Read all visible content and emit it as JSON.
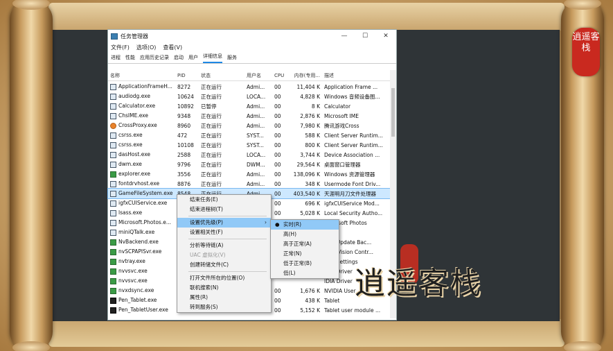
{
  "window": {
    "title": "任务管理器",
    "minimize": "—",
    "maximize": "☐",
    "close": "✕"
  },
  "menubar": [
    "文件(F)",
    "选项(O)",
    "查看(V)"
  ],
  "tabs": [
    "进程",
    "性能",
    "应用历史记录",
    "启动",
    "用户",
    "详细信息",
    "服务"
  ],
  "active_tab": "详细信息",
  "columns": [
    "名称",
    "PID",
    "状态",
    "用户名",
    "CPU",
    "内存(专用...",
    "描述"
  ],
  "rows": [
    {
      "name": "ApplicationFrameH...",
      "pid": "8272",
      "status": "正在运行",
      "user": "Admi...",
      "cpu": "00",
      "mem": "11,404 K",
      "desc": "Application Frame ..."
    },
    {
      "name": "audiodg.exe",
      "pid": "10624",
      "status": "正在运行",
      "user": "LOCA...",
      "cpu": "00",
      "mem": "4,828 K",
      "desc": "Windows 音频设备图..."
    },
    {
      "name": "Calculator.exe",
      "pid": "10892",
      "status": "已暂停",
      "user": "Admi...",
      "cpu": "00",
      "mem": "8 K",
      "desc": "Calculator"
    },
    {
      "name": "ChsIME.exe",
      "pid": "9348",
      "status": "正在运行",
      "user": "Admi...",
      "cpu": "00",
      "mem": "2,876 K",
      "desc": "Microsoft IME"
    },
    {
      "name": "CrossProxy.exe",
      "pid": "8960",
      "status": "正在运行",
      "user": "Admi...",
      "cpu": "00",
      "mem": "7,980 K",
      "desc": "腾讯游戏Cross"
    },
    {
      "name": "csrss.exe",
      "pid": "472",
      "status": "正在运行",
      "user": "SYST...",
      "cpu": "00",
      "mem": "588 K",
      "desc": "Client Server Runtim..."
    },
    {
      "name": "csrss.exe",
      "pid": "10108",
      "status": "正在运行",
      "user": "SYST...",
      "cpu": "00",
      "mem": "800 K",
      "desc": "Client Server Runtim..."
    },
    {
      "name": "dasHost.exe",
      "pid": "2588",
      "status": "正在运行",
      "user": "LOCA...",
      "cpu": "00",
      "mem": "3,744 K",
      "desc": "Device Association ..."
    },
    {
      "name": "dwm.exe",
      "pid": "9796",
      "status": "正在运行",
      "user": "DWM...",
      "cpu": "00",
      "mem": "29,564 K",
      "desc": "桌面窗口管理器"
    },
    {
      "name": "explorer.exe",
      "pid": "3556",
      "status": "正在运行",
      "user": "Admi...",
      "cpu": "00",
      "mem": "138,096 K",
      "desc": "Windows 资源管理器"
    },
    {
      "name": "fontdrvhost.exe",
      "pid": "8876",
      "status": "正在运行",
      "user": "Admi...",
      "cpu": "00",
      "mem": "348 K",
      "desc": "Usermode Font Driv..."
    },
    {
      "name": "GameFileSystem.exe",
      "pid": "8548",
      "status": "正在运行",
      "user": "Admi...",
      "cpu": "00",
      "mem": "403,540 K",
      "desc": "天涯明月刀文件处理器"
    },
    {
      "name": "igfxCUIService.exe",
      "pid": "",
      "status": "",
      "user": "",
      "cpu": "00",
      "mem": "696 K",
      "desc": "igfxCUIService Mod..."
    },
    {
      "name": "lsass.exe",
      "pid": "",
      "status": "",
      "user": "",
      "cpu": "00",
      "mem": "5,028 K",
      "desc": "Local Security Autho..."
    },
    {
      "name": "Microsoft.Photos.e...",
      "pid": "",
      "status": "",
      "user": "",
      "cpu": "",
      "mem": "",
      "desc": "Microsoft Photos"
    },
    {
      "name": "miniQTalk.exe",
      "pid": "",
      "status": "",
      "user": "",
      "cpu": "",
      "mem": "",
      "desc": ""
    },
    {
      "name": "NvBackend.exe",
      "pid": "",
      "status": "",
      "user": "",
      "cpu": "",
      "mem": "",
      "desc": "IDIA Update Bac..."
    },
    {
      "name": "nvSCPAPISvr.exe",
      "pid": "",
      "status": "",
      "user": "",
      "cpu": "",
      "mem": "",
      "desc": "ereo Vision Contr..."
    },
    {
      "name": "nvtray.exe",
      "pid": "",
      "status": "",
      "user": "",
      "cpu": "",
      "mem": "",
      "desc": "IDIA Settings"
    },
    {
      "name": "nvvsvc.exe",
      "pid": "",
      "status": "",
      "user": "",
      "cpu": "",
      "mem": "",
      "desc": "IDIA Driver"
    },
    {
      "name": "nvvsvc.exe",
      "pid": "",
      "status": "",
      "user": "",
      "cpu": "",
      "mem": "",
      "desc": "IDIA Driver"
    },
    {
      "name": "nvxdsync.exe",
      "pid": "",
      "status": "",
      "user": "",
      "cpu": "00",
      "mem": "1,676 K",
      "desc": "NVIDIA User"
    },
    {
      "name": "Pen_Tablet.exe",
      "pid": "",
      "status": "",
      "user": "",
      "cpu": "00",
      "mem": "438 K",
      "desc": "Tablet"
    },
    {
      "name": "Pen_TabletUser.exe",
      "pid": "",
      "status": "",
      "user": "",
      "cpu": "00",
      "mem": "5,152 K",
      "desc": "Tablet user module ..."
    }
  ],
  "context_menu": [
    "结束任务(E)",
    "结束进程树(T)",
    "---",
    "设置优先级(P)",
    "设置相关性(F)",
    "---",
    "分析等待链(A)",
    "UAC 虚拟化(V)",
    "创建转储文件(C)",
    "---",
    "打开文件所在的位置(O)",
    "联机搜索(N)",
    "属性(R)",
    "转到服务(S)"
  ],
  "submenu": [
    "实时(R)",
    "高(H)",
    "高于正常(A)",
    "正常(N)",
    "低于正常(B)",
    "低(L)"
  ],
  "submenu_checked": "实时(R)",
  "seal_text": "逍遥客栈",
  "watermark_text": "逍遥客栈"
}
